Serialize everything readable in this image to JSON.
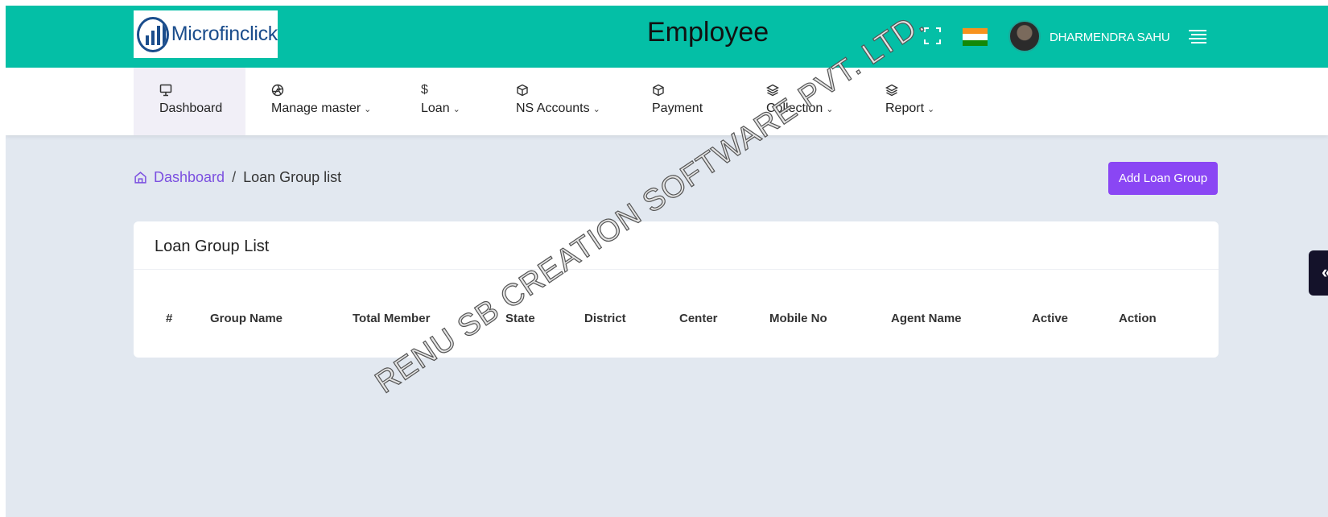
{
  "header": {
    "logo_text": "Microfinclick",
    "page_heading": "Employee",
    "user_name": "DHARMENDRA SAHU"
  },
  "nav": {
    "items": [
      {
        "label": "Dashboard",
        "icon": "monitor-icon"
      },
      {
        "label": "Manage master",
        "icon": "aperture-icon"
      },
      {
        "label": "Loan",
        "icon": "dollar-icon"
      },
      {
        "label": "NS Accounts",
        "icon": "box-icon"
      },
      {
        "label": "Payment",
        "icon": "box-icon"
      },
      {
        "label": "Collection",
        "icon": "layers-icon"
      },
      {
        "label": "Report",
        "icon": "layers-icon"
      }
    ]
  },
  "breadcrumb": {
    "home": "Dashboard",
    "separator": "/",
    "current": "Loan Group list"
  },
  "actions": {
    "add_label": "Add Loan Group"
  },
  "card": {
    "title": "Loan Group List",
    "columns": [
      "#",
      "Group Name",
      "Total Member",
      "State",
      "District",
      "Center",
      "Mobile No",
      "Agent Name",
      "Active",
      "Action"
    ],
    "rows": []
  },
  "side_tab": {
    "glyph": "«"
  },
  "watermark": "RENU SB CREATION SOFTWARE PVT. LTD.",
  "colors": {
    "header_bg": "#04bfa6",
    "accent": "#8a46f4",
    "page_bg": "#e2e8f0"
  }
}
